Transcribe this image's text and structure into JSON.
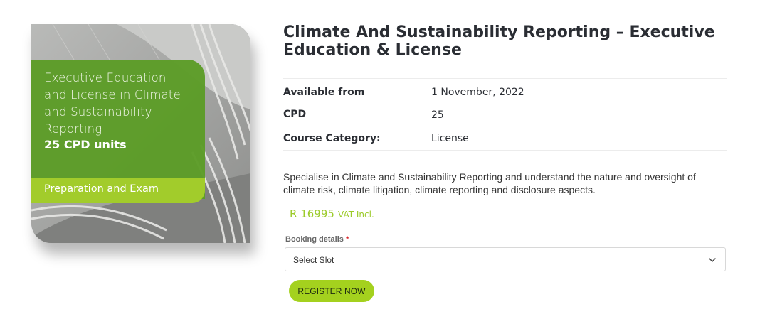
{
  "product_image": {
    "lines": [
      "Executive Education",
      "and License in Climate",
      "and Sustainability",
      "Reporting"
    ],
    "cpd_units": "25 CPD units",
    "band_text": "Preparation and Exam",
    "colors": {
      "panel": "#5c9c26",
      "band": "#a2cc2b"
    }
  },
  "product": {
    "title": "Climate And Sustainability Reporting – Executive Education & License",
    "meta": [
      {
        "label": "Available from",
        "value": "1 November, 2022"
      },
      {
        "label": "CPD",
        "value": "25"
      },
      {
        "label": "Course Category:",
        "value": "License"
      }
    ],
    "description": "Specialise in Climate and Sustainability Reporting and understand the nature and oversight of climate risk, climate litigation, climate reporting and disclosure aspects.",
    "price": {
      "amount": "R 16995",
      "vat": "VAT Incl."
    },
    "booking": {
      "label": "Booking details",
      "required_mark": "*",
      "select_value": "Select Slot"
    },
    "register_label": "REGISTER NOW",
    "colors": {
      "accent": "#a4d11e",
      "price": "#9ccb2a"
    }
  }
}
